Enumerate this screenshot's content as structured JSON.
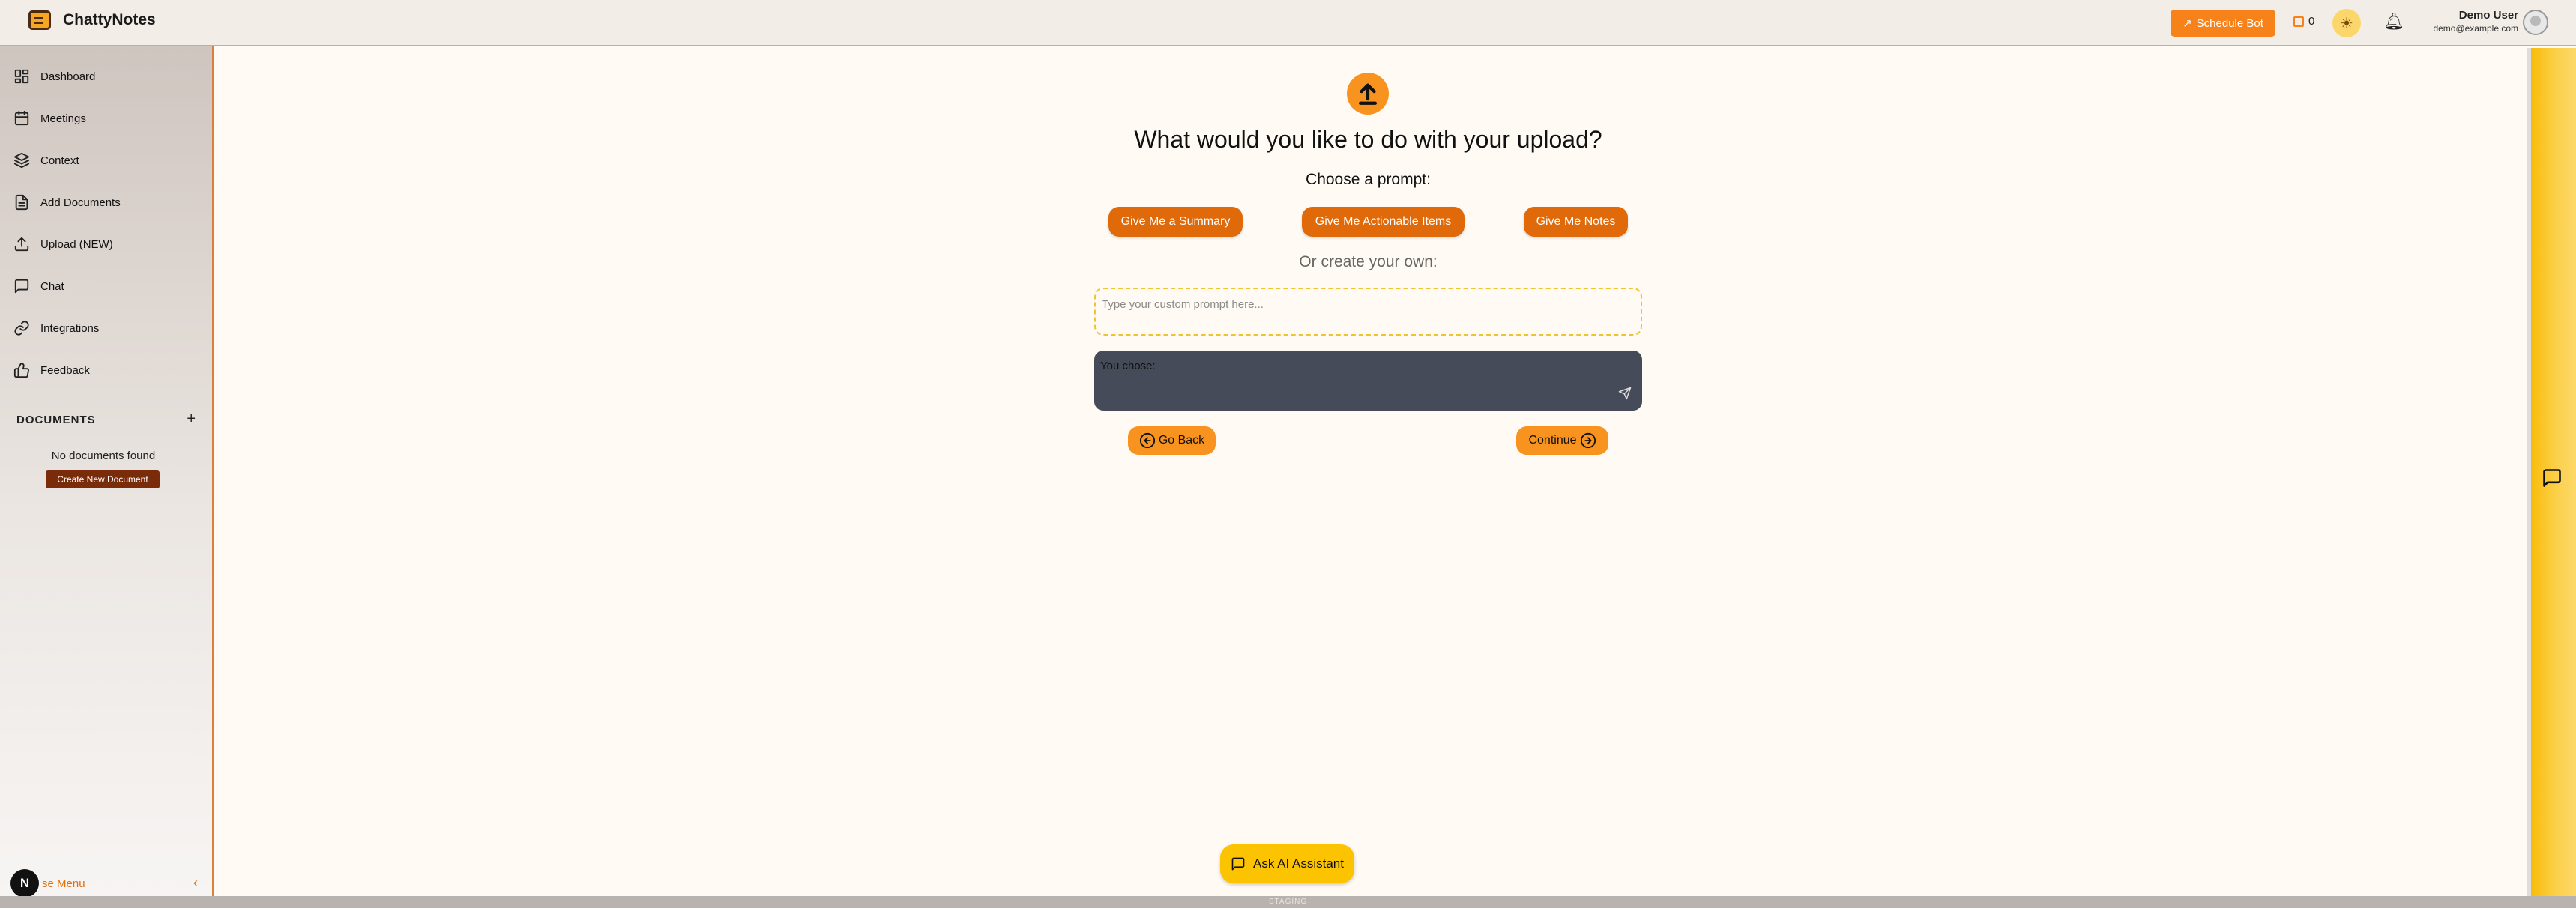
{
  "header": {
    "brand": "ChattyNotes",
    "schedule_bot": "Schedule Bot",
    "credits": "0",
    "user_name": "Demo User",
    "user_email": "demo@example.com"
  },
  "sidebar": {
    "items": [
      {
        "label": "Dashboard",
        "icon": "dashboard-icon"
      },
      {
        "label": "Meetings",
        "icon": "calendar-icon"
      },
      {
        "label": "Context",
        "icon": "layers-icon"
      },
      {
        "label": "Add Documents",
        "icon": "document-icon"
      },
      {
        "label": "Upload (NEW)",
        "icon": "upload-icon"
      },
      {
        "label": "Chat",
        "icon": "chat-icon"
      },
      {
        "label": "Integrations",
        "icon": "link-icon"
      },
      {
        "label": "Feedback",
        "icon": "thumbs-up-icon"
      }
    ],
    "documents_heading": "DOCUMENTS",
    "no_documents": "No documents found",
    "create_document": "Create New Document",
    "close_menu": "se Menu",
    "badge": "N"
  },
  "main": {
    "question": "What would you like to do with your upload?",
    "choose_prompt": "Choose a prompt:",
    "prompts": [
      "Give Me a Summary",
      "Give Me Actionable Items",
      "Give Me Notes"
    ],
    "or_create": "Or create your own:",
    "custom_placeholder": "Type your custom prompt here...",
    "you_chose": "You chose:",
    "go_back": "Go Back",
    "continue": "Continue"
  },
  "assistant": {
    "label": "Ask AI Assistant"
  },
  "footer": {
    "text": "STAGING"
  },
  "colors": {
    "accent": "#f7931e",
    "prompt_button": "#e0690a",
    "ai_button": "#fcc400",
    "chosen_box": "#454b58"
  }
}
